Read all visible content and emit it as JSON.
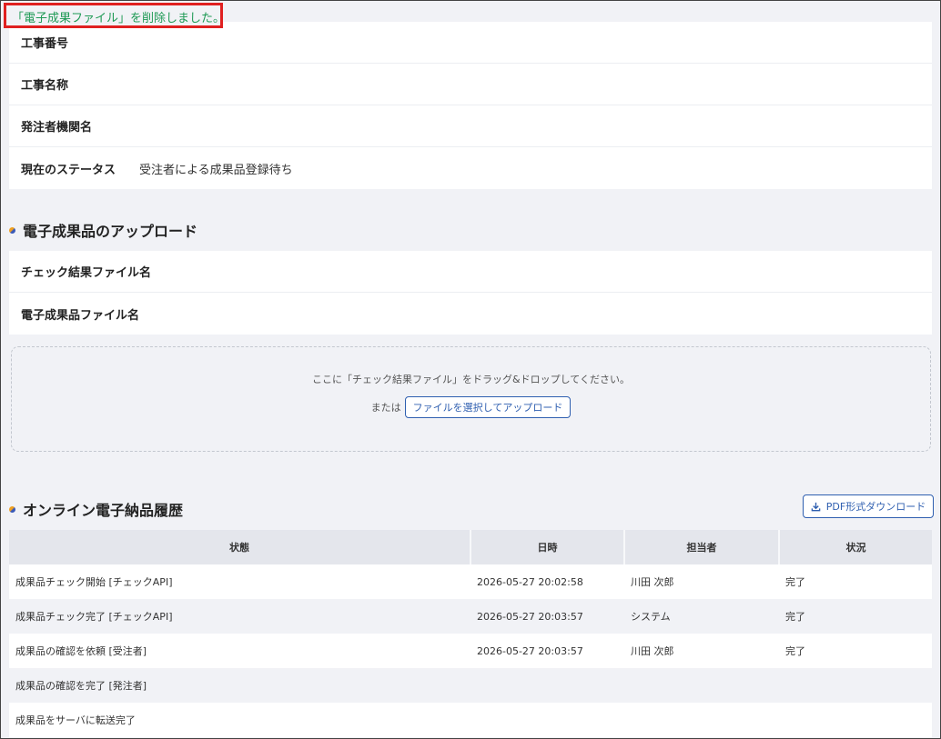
{
  "flash_message": "「電子成果ファイル」を削除しました。",
  "project_info": {
    "rows": [
      {
        "label": "工事番号",
        "value": ""
      },
      {
        "label": "工事名称",
        "value": ""
      },
      {
        "label": "発注者機関名",
        "value": ""
      },
      {
        "label": "現在のステータス",
        "value": "受注者による成果品登録待ち"
      }
    ]
  },
  "upload_section": {
    "title": "電子成果品のアップロード",
    "rows": [
      {
        "label": "チェック結果ファイル名",
        "value": ""
      },
      {
        "label": "電子成果品ファイル名",
        "value": ""
      }
    ],
    "dropzone": {
      "instruction": "ここに「チェック結果ファイル」をドラッグ&ドロップしてください。",
      "or_text": "または",
      "select_button": "ファイルを選択してアップロード"
    }
  },
  "history_section": {
    "title": "オンライン電子納品履歴",
    "pdf_button": "PDF形式ダウンロード",
    "icon": "download-icon",
    "columns": [
      "状態",
      "日時",
      "担当者",
      "状況"
    ],
    "rows": [
      {
        "status": "成果品チェック開始 [チェックAPI]",
        "datetime": "2026-05-27 20:02:58",
        "person": "川田 次郎",
        "state": "完了"
      },
      {
        "status": "成果品チェック完了 [チェックAPI]",
        "datetime": "2026-05-27 20:03:57",
        "person": "システム",
        "state": "完了"
      },
      {
        "status": "成果品の確認を依頼 [受注者]",
        "datetime": "2026-05-27 20:03:57",
        "person": "川田 次郎",
        "state": "完了"
      },
      {
        "status": "成果品の確認を完了 [発注者]",
        "datetime": "",
        "person": "",
        "state": ""
      },
      {
        "status": "成果品をサーバに転送完了",
        "datetime": "",
        "person": "",
        "state": ""
      }
    ]
  },
  "colors": {
    "flash_text": "#1f9a55",
    "flash_border": "#e02020",
    "accent_blue": "#2f5fb0",
    "page_bg": "#f1f2f6"
  }
}
